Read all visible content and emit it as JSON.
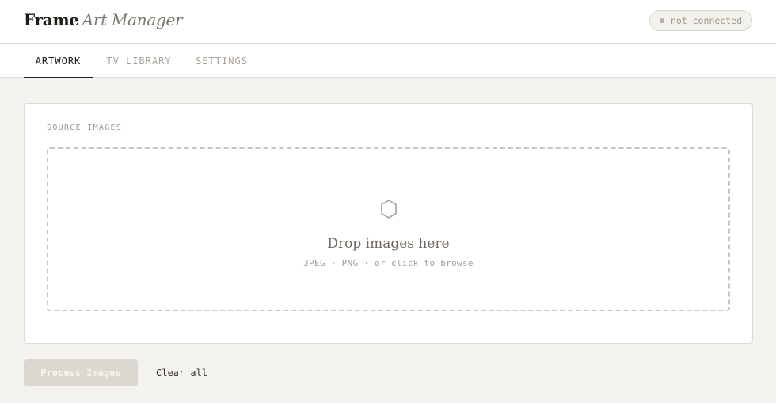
{
  "header": {
    "brand_name": "Frame",
    "brand_sub": "Art Manager",
    "status": "not connected"
  },
  "tabs": [
    {
      "label": "ARTWORK",
      "active": true
    },
    {
      "label": "TV LIBRARY",
      "active": false
    },
    {
      "label": "SETTINGS",
      "active": false
    }
  ],
  "source": {
    "label": "SOURCE IMAGES",
    "icon": "hexagon-icon",
    "drop_title": "Drop images here",
    "drop_hint": "JPEG · PNG · or click to browse"
  },
  "actions": {
    "process_label": "Process Images",
    "clear_label": "Clear all"
  },
  "colors": {
    "background": "#f5f3ef",
    "accent": "#1f1c18",
    "muted": "#9e978c",
    "disabled_button": "#dcd8d0"
  }
}
